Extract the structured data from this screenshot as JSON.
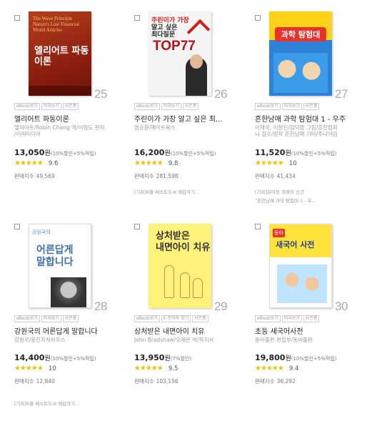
{
  "books": [
    {
      "rank": "25",
      "cover": {
        "en_title": "The Wave Principle Nature's Law Financial World Articles",
        "ko_title": "엘리어트 파동이론"
      },
      "tags": [
        "eBook보기",
        "미리보기",
        "사은품"
      ],
      "title": "엘리어트 파동이론",
      "author_lines": [
        "엘리어트/Robin Chang 역/이형도 편저",
        "/이레미디어"
      ],
      "price": "13,050",
      "won": "원",
      "discount": "(10%할인+5%적립)",
      "stars": "★★★★★",
      "score": "9.6",
      "sales_label": "판매지수",
      "sales_num": "49,569",
      "notes": []
    },
    {
      "rank": "26",
      "cover": {
        "line1": "주린이가 가장",
        "line2": "알고 싶은",
        "line3": "최다질문",
        "big": "TOP77"
      },
      "tags": [
        "eBook보기",
        "미리보기",
        "사은품"
      ],
      "title": "주린이가 가장 알고 싶은 최...",
      "author_lines": [
        "염승환/메이트북스"
      ],
      "price": "16,200",
      "won": "원",
      "discount": "(10%할인+5%적립)",
      "stars": "★★★★★",
      "score": "9.8",
      "sales_label": "판매지수",
      "sales_num": "281,598",
      "notes": [
        "[기획]6월 베스트도서 예감하기..."
      ]
    },
    {
      "rank": "27",
      "cover": {
        "title": "과학 탐험대"
      },
      "tags": [
        "eBook보기",
        "미리보기",
        "사은품"
      ],
      "title": "흔한남매 과학 탐험대 1 - 우주",
      "author_lines": [
        "이재국, 이형진/김덕영 그림/흔한컴퍼",
        "니 감수/원작 흔한남매 기타/주니어김"
      ],
      "price": "11,520",
      "won": "원",
      "discount": "(10%할인+5%적립)",
      "stars": "★★★★★",
      "score": "10",
      "sales_label": "판매지수",
      "sales_num": "41,434",
      "notes": [
        "[기획]유아동 최애의 신간",
        "\"흔한남매 과학 탐험대 1 - 우..."
      ]
    },
    {
      "rank": "28",
      "cover": {
        "small": "강원국의",
        "line1": "어른답게",
        "line2": "말합니다"
      },
      "tags": [
        "eBook보기",
        "미리보기",
        "사은품"
      ],
      "title": "강원국의 어른답게 말합니다",
      "author_lines": [
        "강원국/웅진지식하우스"
      ],
      "price": "14,400",
      "won": "원",
      "discount": "(10%할인+5%적립)",
      "stars": "★★★★★",
      "score": "10",
      "sales_label": "판매지수",
      "sales_num": "12,840",
      "notes": [
        "[기획]6월 베스트도서 예감하기..."
      ]
    },
    {
      "rank": "29",
      "cover": {
        "line1": "상처받은",
        "line2": "내면아이 치유"
      },
      "tags": [
        "eBook보기",
        "E-전자북 찾기",
        "사은품"
      ],
      "title": "상처받은 내면아이 치유",
      "author_lines": [
        "John Bradshaw/오제은 역/학지사"
      ],
      "price": "13,950",
      "won": "원",
      "discount": "(7%할인)",
      "stars": "★★★★★",
      "score": "9.5",
      "sales_label": "판매지수",
      "sales_num": "103,156",
      "notes": []
    },
    {
      "rank": "30",
      "cover": {
        "badge": "동아",
        "title": "새국어 사전"
      },
      "tags": [
        "eBook보기",
        "미리보기",
        "사은품"
      ],
      "title": "초등 새국어사전",
      "author_lines": [
        "동아출판 편집부/동아출판"
      ],
      "price": "19,800",
      "won": "원",
      "discount": "(10%할인+5%적립)",
      "stars": "★★★★★",
      "score": "9.4",
      "sales_label": "판매지수",
      "sales_num": "36,292",
      "notes": []
    }
  ]
}
